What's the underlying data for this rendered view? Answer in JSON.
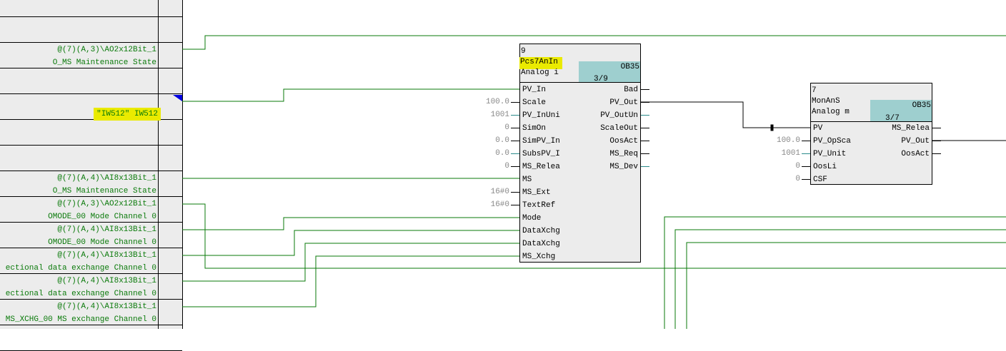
{
  "sheet_bar": {
    "rows": [
      {
        "l1": "",
        "l2": ""
      },
      {
        "l1": "",
        "l2": ""
      },
      {
        "l1": "@(7)(A,3)\\AO2x12Bit_1",
        "l2": "O_MS Maintenance State"
      },
      {
        "l1": "",
        "l2": ""
      },
      {
        "l1": "",
        "l2": "\"IW512\" IW512",
        "highlight": true
      },
      {
        "l1": "",
        "l2": ""
      },
      {
        "l1": "",
        "l2": ""
      },
      {
        "l1": "@(7)(A,4)\\AI8x13Bit_1",
        "l2": "O_MS Maintenance State"
      },
      {
        "l1": "@(7)(A,3)\\AO2x12Bit_1",
        "l2": "OMODE_00 Mode Channel 0"
      },
      {
        "l1": "@(7)(A,4)\\AI8x13Bit_1",
        "l2": "OMODE_00 Mode Channel 0"
      },
      {
        "l1": "@(7)(A,4)\\AI8x13Bit_1",
        "l2": "ectional data exchange Channel 0"
      },
      {
        "l1": "@(7)(A,4)\\AI8x13Bit_1",
        "l2": "ectional data exchange Channel 0"
      },
      {
        "l1": "@(7)(A,4)\\AI8x13Bit_1",
        "l2": "MS_XCHG_00 MS exchange Channel 0"
      },
      {
        "l1": "",
        "l2": ""
      }
    ]
  },
  "blocks": [
    {
      "number": "9",
      "type": "Pcs7AnIn",
      "comment": "Analog i",
      "ob": "OB35",
      "seq": "3/9",
      "highlight_type": true,
      "inputs": [
        {
          "name": "PV_In",
          "value": ""
        },
        {
          "name": "Scale",
          "value": "100.0"
        },
        {
          "name": "PV_InUni",
          "value": "1001"
        },
        {
          "name": "SimOn",
          "value": "0"
        },
        {
          "name": "SimPV_In",
          "value": "0.0"
        },
        {
          "name": "SubsPV_I",
          "value": "0.0"
        },
        {
          "name": "MS_Relea",
          "value": "0"
        },
        {
          "name": "MS",
          "value": ""
        },
        {
          "name": "MS_Ext",
          "value": "16#0"
        },
        {
          "name": "TextRef",
          "value": "16#0"
        },
        {
          "name": "Mode",
          "value": ""
        },
        {
          "name": "DataXchg",
          "value": ""
        },
        {
          "name": "DataXchg",
          "value": ""
        },
        {
          "name": "MS_Xchg",
          "value": ""
        }
      ],
      "outputs": [
        "Bad",
        "PV_Out",
        "PV_OutUn",
        "ScaleOut",
        "OosAct",
        "MS_Req",
        "MS_Dev"
      ]
    },
    {
      "number": "7",
      "type": "MonAnS",
      "comment": "Analog m",
      "ob": "OB35",
      "seq": "3/7",
      "inputs": [
        {
          "name": "PV",
          "value": ""
        },
        {
          "name": "PV_OpSca",
          "value": "100.0"
        },
        {
          "name": "PV_Unit",
          "value": "1001"
        },
        {
          "name": "OosLi",
          "value": "0"
        },
        {
          "name": "CSF",
          "value": "0"
        }
      ],
      "outputs": [
        "MS_Relea",
        "PV_Out",
        "OosAct"
      ]
    }
  ],
  "colors": {
    "wire": "#0a7a0a",
    "teal": "#9ecfcf"
  }
}
